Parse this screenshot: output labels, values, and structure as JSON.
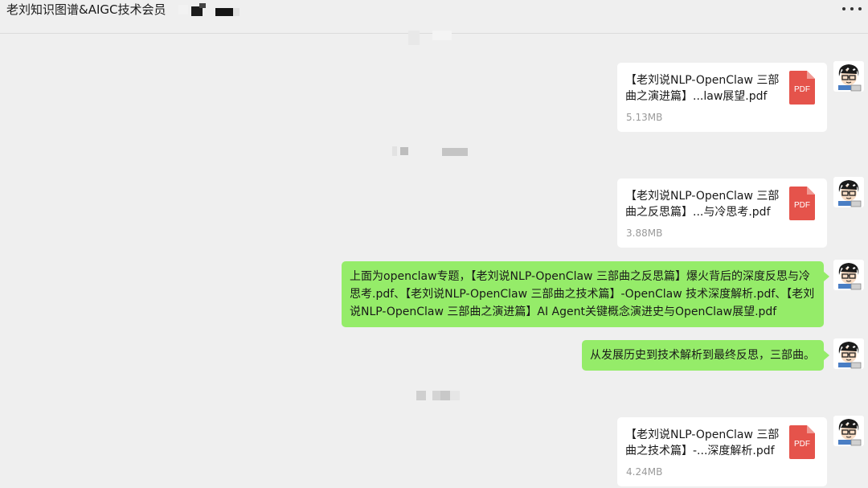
{
  "header": {
    "title": "老刘知识图谱&AIGC技术会员",
    "more_icon": "more-horizontal-icon"
  },
  "messages": [
    {
      "kind": "file",
      "name": "【老刘说NLP-OpenClaw 三部曲之演进篇】...law展望.pdf",
      "size": "5.13MB",
      "icon": "PDF"
    },
    {
      "kind": "file",
      "name": "【老刘说NLP-OpenClaw 三部曲之反思篇】...与冷思考.pdf",
      "size": "3.88MB",
      "icon": "PDF"
    },
    {
      "kind": "text",
      "text": "上面为openclaw专题，【老刘说NLP-OpenClaw 三部曲之反思篇】爆火背后的深度反思与冷思考.pdf、【老刘说NLP-OpenClaw 三部曲之技术篇】-OpenClaw 技术深度解析.pdf、【老刘说NLP-OpenClaw 三部曲之演进篇】AI Agent关键概念演进史与OpenClaw展望.pdf"
    },
    {
      "kind": "text",
      "text": "从发展历史到技术解析到最终反思，三部曲。"
    },
    {
      "kind": "file",
      "name": "【老刘说NLP-OpenClaw 三部曲之技术篇】-...深度解析.pdf",
      "size": "4.24MB",
      "icon": "PDF"
    }
  ],
  "colors": {
    "background": "#efefef",
    "bubble_green": "#95ec69",
    "pdf_red": "#e5534b",
    "card": "#ffffff",
    "size_text": "#9a9a9a"
  }
}
